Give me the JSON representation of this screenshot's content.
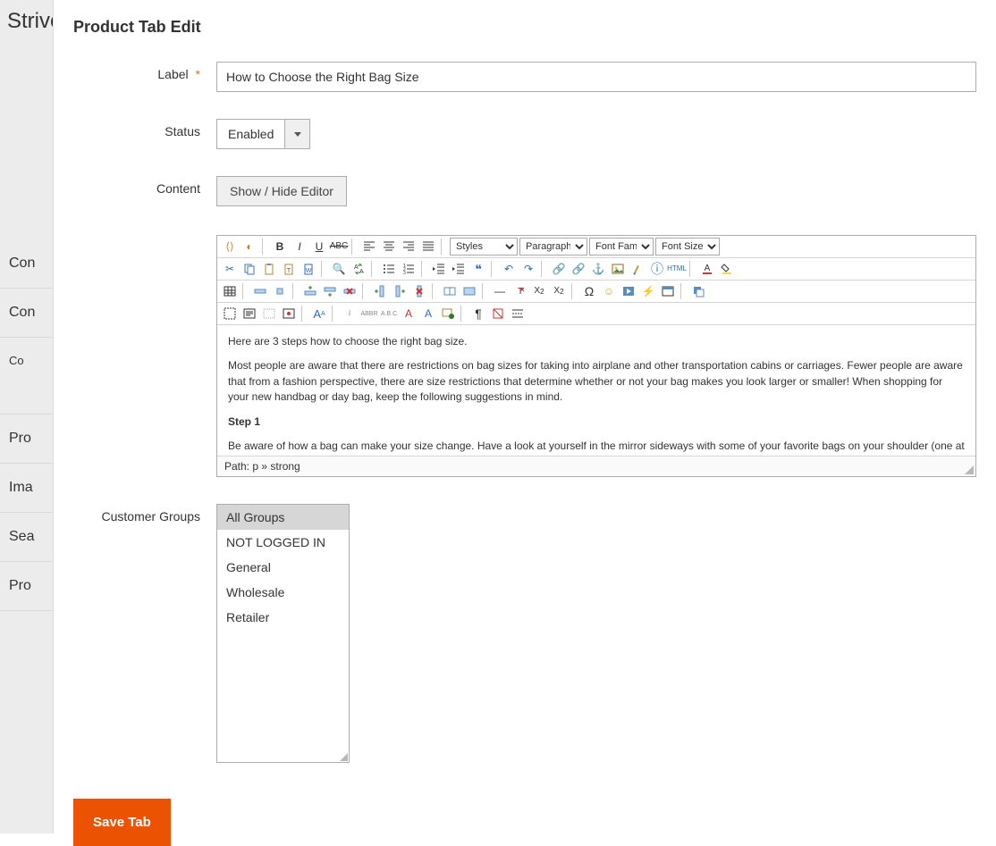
{
  "background_title": "Strive",
  "background_menu": [
    "Con",
    "Con",
    "Co",
    "Pro",
    "Ima",
    "Sea",
    "Pro"
  ],
  "page_title": "Product Tab Edit",
  "fields": {
    "label_label": "Label",
    "label_value": "How to Choose the Right Bag Size",
    "status_label": "Status",
    "status_value": "Enabled",
    "content_label": "Content",
    "editor_toggle": "Show / Hide Editor",
    "customer_groups_label": "Customer Groups"
  },
  "editor_toolbar": {
    "selects": {
      "styles": "Styles",
      "paragraph": "Paragraph",
      "font_family": "Font Family",
      "font_size": "Font Size"
    }
  },
  "editor_body": {
    "intro": "Here are 3 steps how to choose the right bag size.",
    "p2": "Most people are aware that there are restrictions on bag sizes for taking into airplane and other transportation cabins or carriages. Fewer people are aware that from a fashion perspective, there are size restrictions that determine whether or not your bag makes you look larger or smaller! When shopping for your new handbag or day bag, keep the following suggestions in mind.",
    "step_heading": "Step 1",
    "p3": "Be aware of how a bag can make your size change. Have a look at yourself in the mirror sideways with some of your favorite bags on your shoulder (one at a time). See if you can notice the following:"
  },
  "editor_path": "Path: p » strong",
  "customer_groups": [
    "All Groups",
    "NOT LOGGED IN",
    "General",
    "Wholesale",
    "Retailer"
  ],
  "customer_groups_selected": 0,
  "save_button": "Save Tab"
}
